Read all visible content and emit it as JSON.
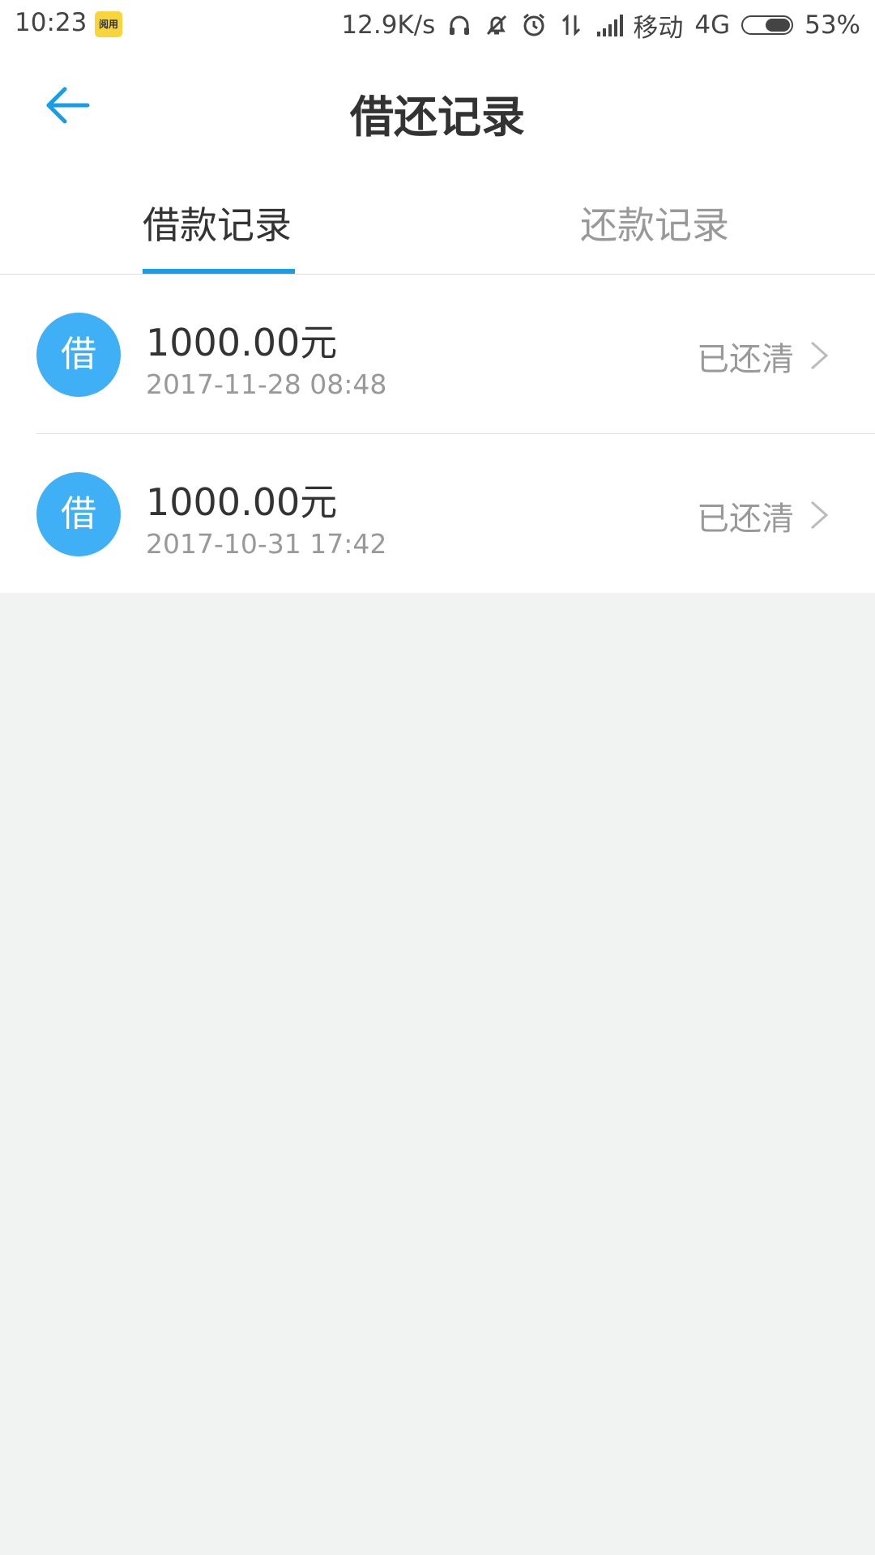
{
  "status_bar": {
    "time": "10:23",
    "app_badge": "阅用",
    "net_speed": "12.9K/s",
    "carrier": "移动",
    "network": "4G",
    "battery": "53%",
    "battery_level": 0.53
  },
  "header": {
    "title": "借还记录"
  },
  "tabs": [
    {
      "label": "借款记录",
      "active": true
    },
    {
      "label": "还款记录",
      "active": false
    }
  ],
  "records": [
    {
      "badge": "借",
      "amount": "1000.00元",
      "date": "2017-11-28 08:48",
      "status": "已还清"
    },
    {
      "badge": "借",
      "amount": "1000.00元",
      "date": "2017-10-31 17:42",
      "status": "已还清"
    }
  ],
  "colors": {
    "accent": "#1a9de8",
    "badge": "#3fb0f5",
    "background": "#f1f2f2"
  }
}
